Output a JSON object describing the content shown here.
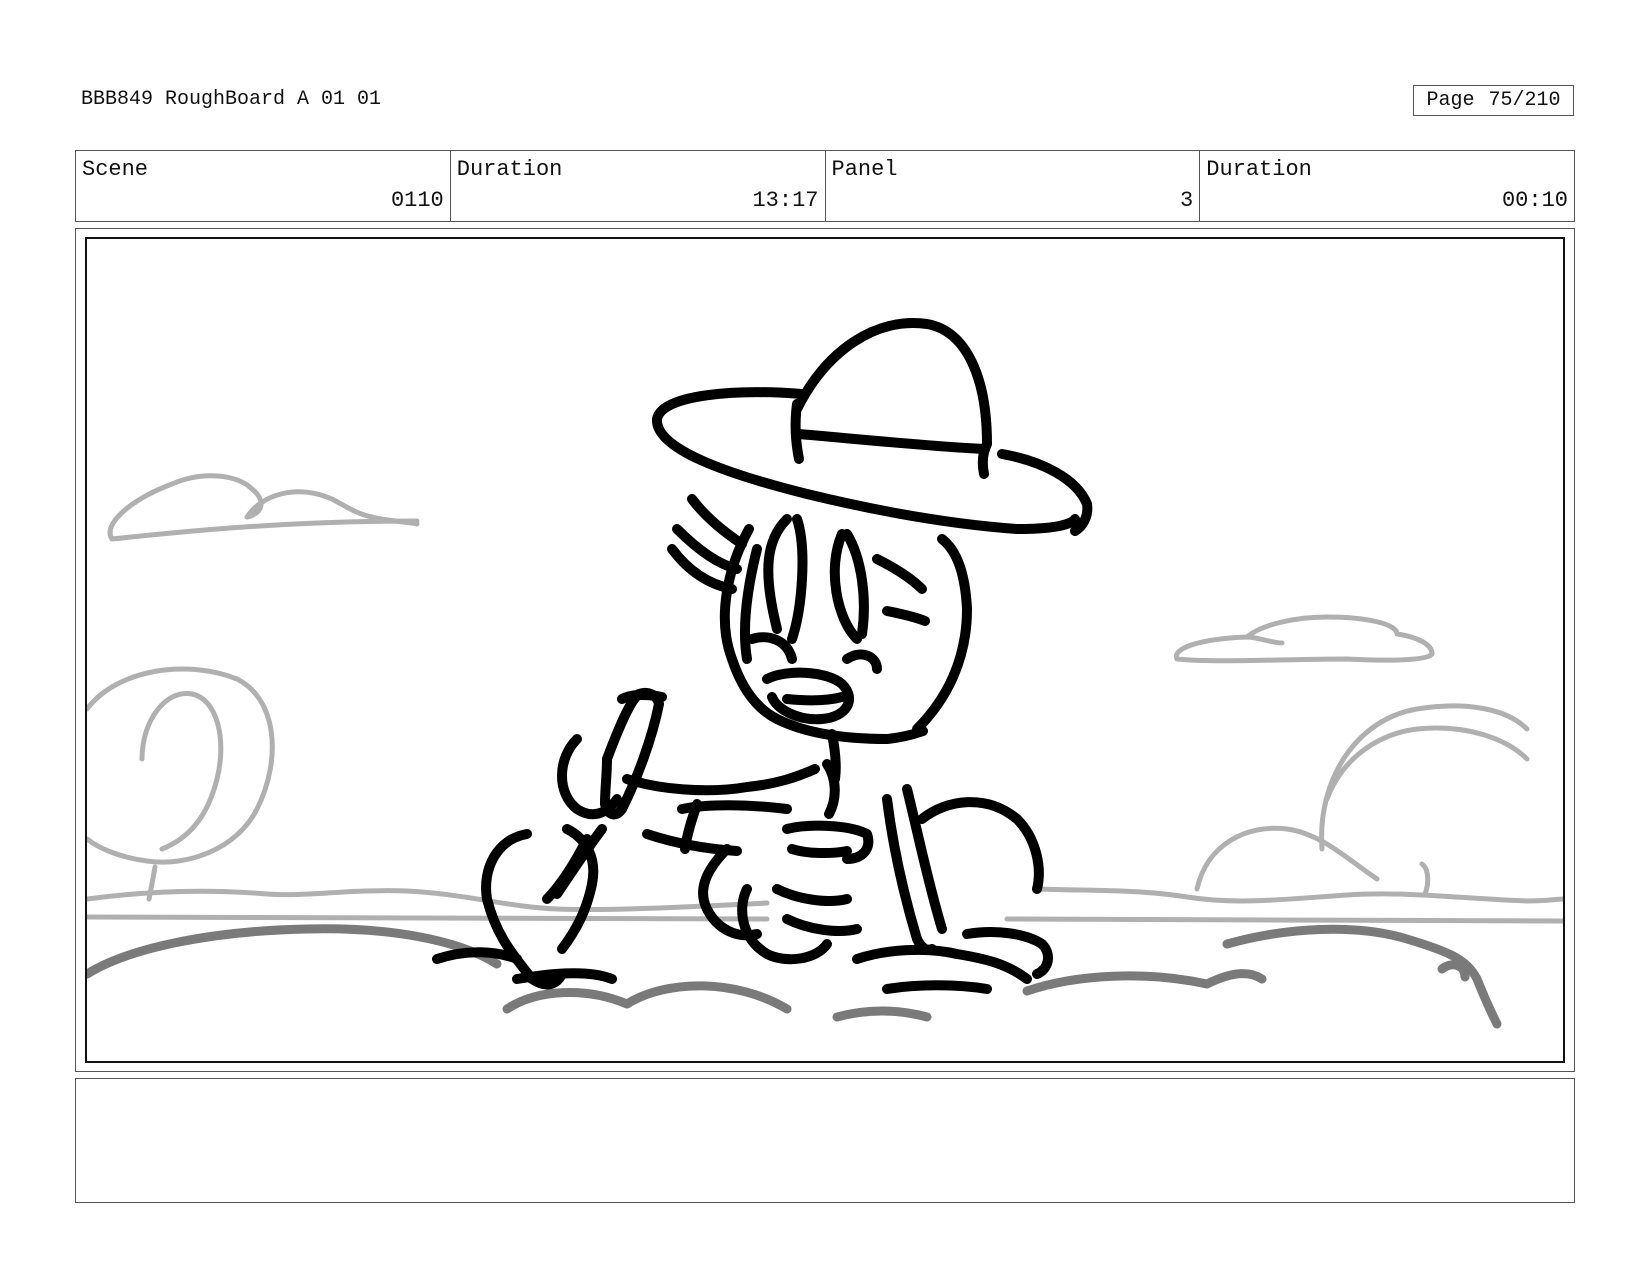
{
  "header": {
    "title": "BBB849 RoughBoard A 01 01",
    "page_label": "Page",
    "page_number": "75/210"
  },
  "info": {
    "scene_label": "Scene",
    "scene_value": "0110",
    "scene_duration_label": "Duration",
    "scene_duration_value": "13:17",
    "panel_label": "Panel",
    "panel_value": "3",
    "panel_duration_label": "Duration",
    "panel_duration_value": "00:10"
  },
  "frame": {
    "ink_color": "#000000",
    "background_sketch_color": "#b0b0b0",
    "ground_sketch_color": "#7a7a7a"
  },
  "notes": {
    "text": ""
  }
}
